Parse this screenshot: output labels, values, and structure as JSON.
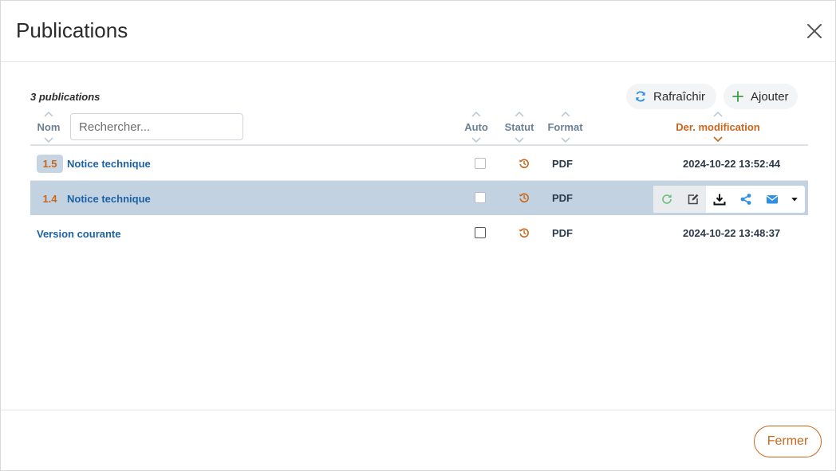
{
  "modal": {
    "title": "Publications",
    "close_icon": "close-icon"
  },
  "toolbar": {
    "count_label": "3 publications",
    "refresh_label": "Rafraîchir",
    "refresh_icon": "refresh-icon",
    "add_label": "Ajouter",
    "add_icon": "plus-icon"
  },
  "search": {
    "placeholder": "Rechercher...",
    "value": ""
  },
  "columns": {
    "name": "Nom",
    "auto": "Auto",
    "status": "Statut",
    "format": "Format",
    "modified": "Der. modification",
    "active_sort": "modified"
  },
  "rows": [
    {
      "version": "1.5",
      "name": "Notice technique",
      "auto": false,
      "status_icon": "history-icon",
      "format": "PDF",
      "modified": "2024-10-22 13:52:44",
      "selected": false
    },
    {
      "version": "1.4",
      "name": "Notice technique",
      "auto": false,
      "status_icon": "history-icon",
      "format": "PDF",
      "modified": "",
      "selected": true
    },
    {
      "version": "",
      "name": "Version courante",
      "auto": false,
      "status_icon": "history-icon",
      "format": "PDF",
      "modified": "2024-10-22 13:48:37",
      "selected": false
    }
  ],
  "row_actions": [
    "regenerate-icon",
    "edit-icon",
    "download-icon",
    "share-icon",
    "email-icon",
    "caret-down-icon"
  ],
  "footer": {
    "close_label": "Fermer"
  },
  "colors": {
    "accent": "#c8661b",
    "link": "#1b62a5",
    "selected_row": "#c2d2e1",
    "header_text": "#6a7f92"
  }
}
